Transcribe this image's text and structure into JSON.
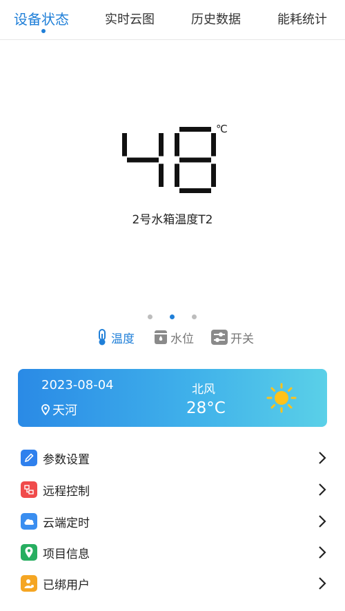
{
  "tabs": [
    {
      "label": "设备状态",
      "active": true
    },
    {
      "label": "实时云图",
      "active": false
    },
    {
      "label": "历史数据",
      "active": false
    },
    {
      "label": "能耗统计",
      "active": false
    }
  ],
  "display": {
    "value": "48",
    "unit": "℃",
    "caption": "2号水箱温度T2"
  },
  "pager": {
    "count": 3,
    "active_index": 1
  },
  "type_switch": [
    {
      "label": "温度",
      "icon": "thermometer-icon",
      "active": true
    },
    {
      "label": "水位",
      "icon": "tank-icon",
      "active": false
    },
    {
      "label": "开关",
      "icon": "switch-icon",
      "active": false
    }
  ],
  "weather": {
    "date": "2023-08-04",
    "location": "天河",
    "wind": "北风",
    "temperature": "28°C",
    "icon": "sun-icon"
  },
  "menu": [
    {
      "label": "参数设置",
      "icon": "edit-icon",
      "color": "#2f80ed"
    },
    {
      "label": "远程控制",
      "icon": "remote-control-icon",
      "color": "#f04b4b"
    },
    {
      "label": "云端定时",
      "icon": "cloud-icon",
      "color": "#3a8ef0"
    },
    {
      "label": "项目信息",
      "icon": "location-icon",
      "color": "#27ae60"
    },
    {
      "label": "已绑用户",
      "icon": "user-icon",
      "color": "#f5a623"
    }
  ],
  "colors": {
    "accent": "#1f7fd8",
    "inactive": "#777777"
  }
}
